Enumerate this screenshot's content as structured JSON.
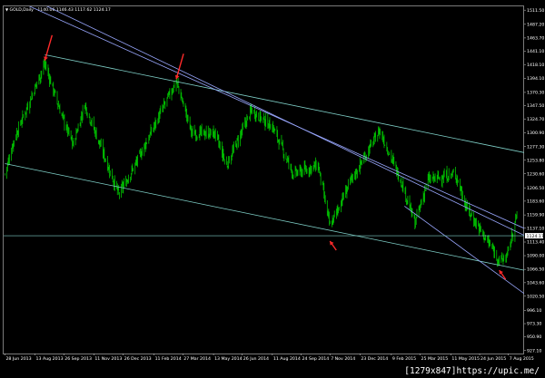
{
  "header": {
    "symbol": "GOLD,Daily",
    "ohlc": "1140.06 1146.43 1117.62 1124.17"
  },
  "watermark": "[1279x847]https://upic.me/",
  "colors": {
    "background": "#000000",
    "candle": "#00c000",
    "trendline": "#7fd0c8",
    "channel": "#9aa8ff",
    "arrow": "#ff2a2a",
    "price_tag_bg": "#ffffff",
    "price_tag_text": "#000000",
    "border": "#7a7a7a"
  },
  "price_axis": {
    "labels": [
      "1511.50",
      "1487.20",
      "1463.70",
      "1441.10",
      "1418.10",
      "1394.10",
      "1370.30",
      "1347.50",
      "1324.70",
      "1300.90",
      "1277.30",
      "1253.80",
      "1230.60",
      "1206.50",
      "1183.60",
      "1159.90",
      "1137.10",
      "1113.40",
      "1090.00",
      "1066.50",
      "1043.60",
      "1020.50",
      "996.10",
      "973.30",
      "950.90",
      "927.10"
    ],
    "current": "1124.17"
  },
  "time_axis": {
    "labels": [
      "28 Jun 2013",
      "13 Aug 2013",
      "26 Sep 2013",
      "11 Nov 2013",
      "26 Dec 2013",
      "11 Feb 2014",
      "27 Mar 2014",
      "13 May 2014",
      "26 Jun 2014",
      "11 Aug 2014",
      "24 Sep 2014",
      "7 Nov 2014",
      "23 Dec 2014",
      "9 Feb 2015",
      "25 Mar 2015",
      "11 May 2015",
      "24 Jun 2015",
      "7 Aug 2015"
    ]
  },
  "chart_data": {
    "type": "candlestick",
    "title": "GOLD,Daily",
    "timeframe": "Daily",
    "x_range": [
      "2013-06-28",
      "2015-08-20"
    ],
    "ylim": [
      927.1,
      1511.5
    ],
    "current_price": 1124.17,
    "price_path": [
      {
        "date": "2013-06-28",
        "price": 1230
      },
      {
        "date": "2013-07-12",
        "price": 1290
      },
      {
        "date": "2013-08-28",
        "price": 1420
      },
      {
        "date": "2013-09-20",
        "price": 1340
      },
      {
        "date": "2013-10-10",
        "price": 1280
      },
      {
        "date": "2013-10-28",
        "price": 1350
      },
      {
        "date": "2013-12-19",
        "price": 1195
      },
      {
        "date": "2014-01-15",
        "price": 1250
      },
      {
        "date": "2014-03-17",
        "price": 1390
      },
      {
        "date": "2014-04-10",
        "price": 1300
      },
      {
        "date": "2014-05-15",
        "price": 1300
      },
      {
        "date": "2014-06-02",
        "price": 1245
      },
      {
        "date": "2014-07-10",
        "price": 1340
      },
      {
        "date": "2014-08-12",
        "price": 1310
      },
      {
        "date": "2014-09-12",
        "price": 1230
      },
      {
        "date": "2014-10-20",
        "price": 1245
      },
      {
        "date": "2014-11-07",
        "price": 1140
      },
      {
        "date": "2014-12-05",
        "price": 1210
      },
      {
        "date": "2015-01-22",
        "price": 1305
      },
      {
        "date": "2015-02-25",
        "price": 1215
      },
      {
        "date": "2015-03-17",
        "price": 1145
      },
      {
        "date": "2015-04-06",
        "price": 1220
      },
      {
        "date": "2015-05-18",
        "price": 1230
      },
      {
        "date": "2015-06-05",
        "price": 1170
      },
      {
        "date": "2015-07-20",
        "price": 1090
      },
      {
        "date": "2015-07-24",
        "price": 1080
      },
      {
        "date": "2015-08-05",
        "price": 1090
      },
      {
        "date": "2015-08-20",
        "price": 1160
      }
    ],
    "lines": [
      {
        "kind": "trendline",
        "from": {
          "date": "2013-08-28",
          "price": 1435
        },
        "to": {
          "date": "2015-08-31",
          "price": 1267
        }
      },
      {
        "kind": "trendline",
        "from": {
          "date": "2013-06-28",
          "price": 1248
        },
        "to": {
          "date": "2015-08-31",
          "price": 1065
        }
      },
      {
        "kind": "channel",
        "from": {
          "date": "2013-08-01",
          "price": 1520
        },
        "to": {
          "date": "2015-08-31",
          "price": 1137
        }
      },
      {
        "kind": "channel",
        "from": {
          "date": "2013-08-28",
          "price": 1520
        },
        "to": {
          "date": "2015-08-31",
          "price": 1125
        }
      },
      {
        "kind": "channel",
        "from": {
          "date": "2015-03-01",
          "price": 1175
        },
        "to": {
          "date": "2015-08-31",
          "price": 1025
        }
      },
      {
        "kind": "horizontal",
        "price": 1124.17
      }
    ],
    "arrows": [
      {
        "date": "2013-08-28",
        "price": 1425,
        "direction": "down"
      },
      {
        "date": "2014-03-17",
        "price": 1393,
        "direction": "down"
      },
      {
        "date": "2014-11-07",
        "price": 1115,
        "direction": "up"
      },
      {
        "date": "2015-07-24",
        "price": 1065,
        "direction": "up"
      }
    ]
  }
}
